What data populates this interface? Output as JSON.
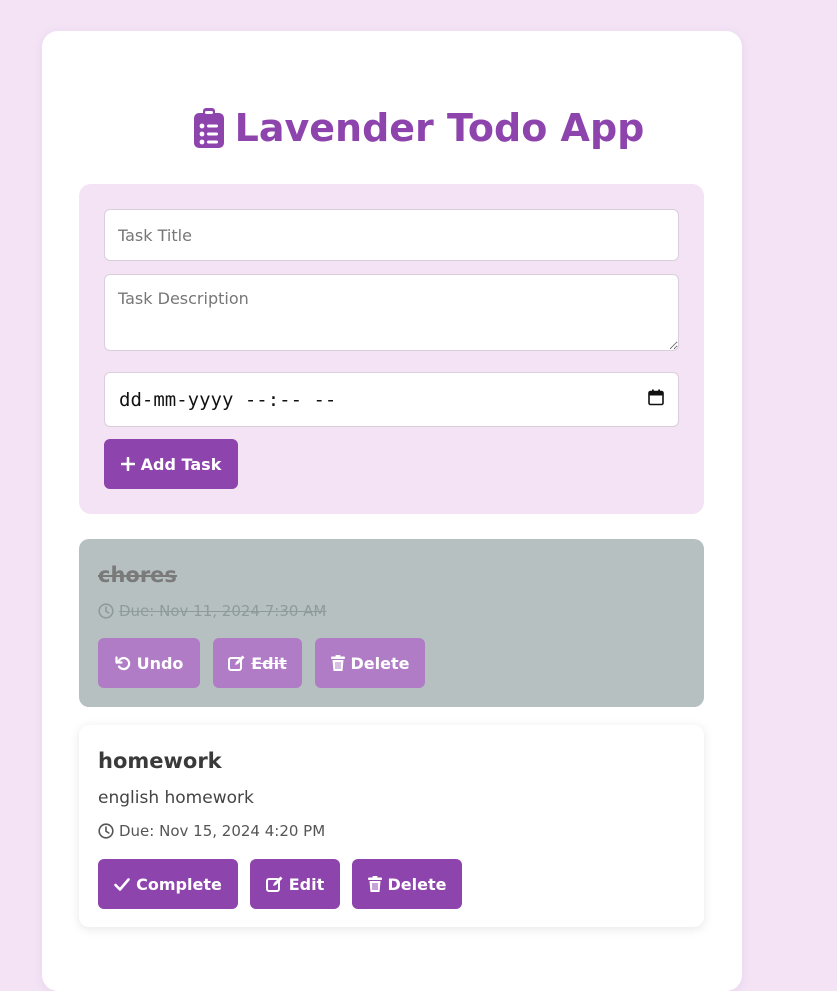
{
  "app": {
    "title": "Lavender Todo App",
    "icons": {
      "title": "clipboard-list-icon"
    },
    "colors": {
      "accent": "#8e44ad",
      "background": "#f3e3f5",
      "completed_bg": "#b6c0c0",
      "completed_button": "#b07cc6"
    }
  },
  "form": {
    "title_placeholder": "Task Title",
    "description_placeholder": "Task Description",
    "date_value": "dd-mm-yyyy --:-- --",
    "add_button": "Add Task"
  },
  "tasks": [
    {
      "title": "chores",
      "description": "",
      "due": "Due: Nov 11, 2024 7:30 AM",
      "completed": true,
      "buttons": {
        "toggle": "Undo",
        "edit": "Edit",
        "delete": "Delete"
      }
    },
    {
      "title": "homework",
      "description": "english homework",
      "due": "Due: Nov 15, 2024 4:20 PM",
      "completed": false,
      "buttons": {
        "toggle": "Complete",
        "edit": "Edit",
        "delete": "Delete"
      }
    }
  ]
}
